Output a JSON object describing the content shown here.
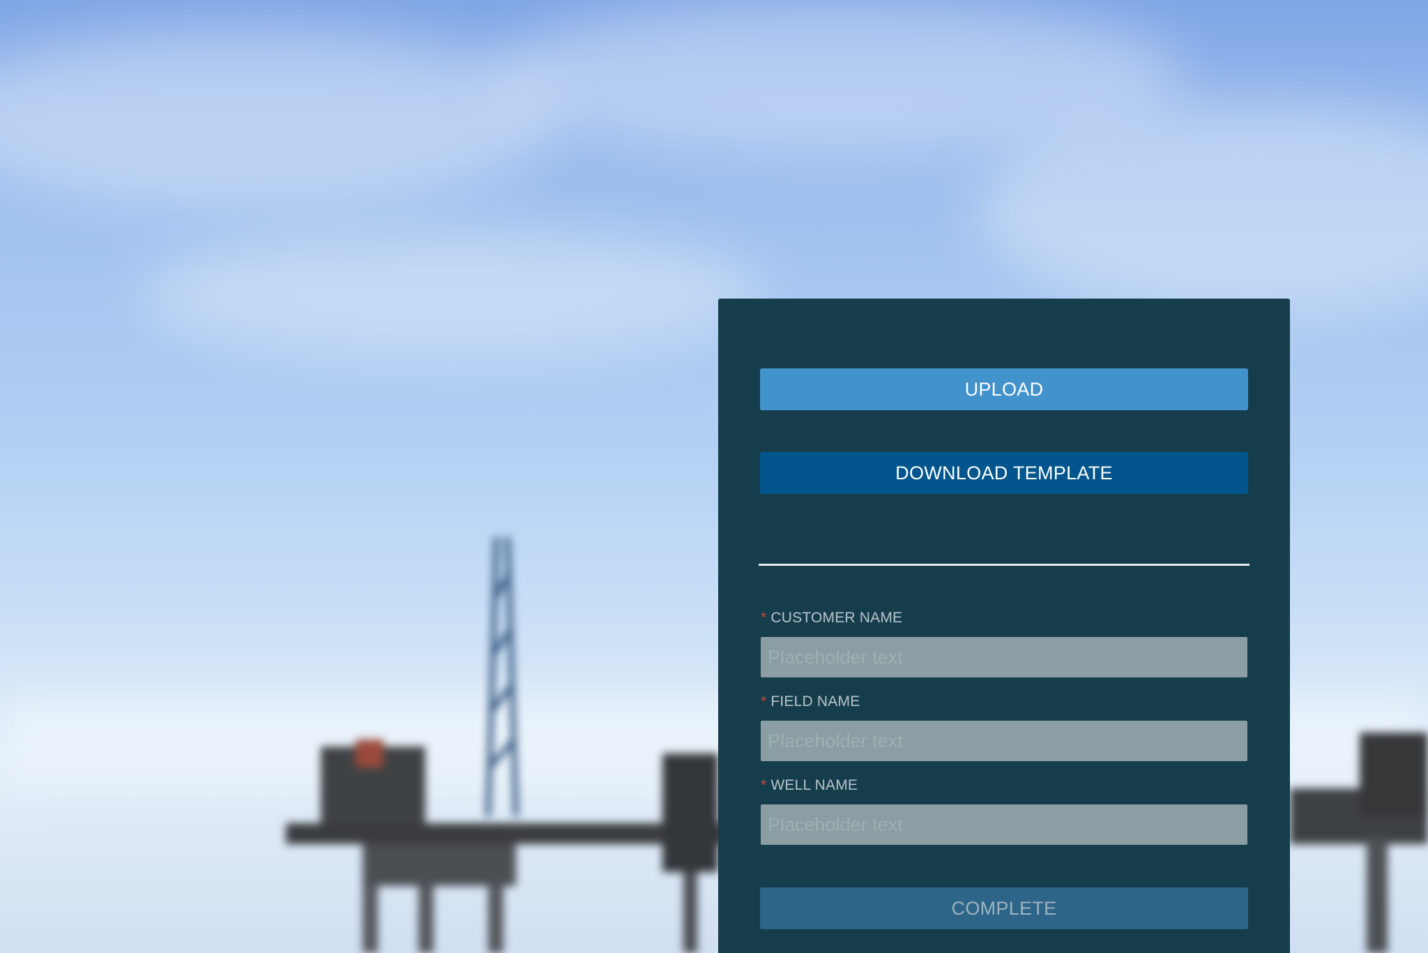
{
  "form": {
    "upload_label": "UPLOAD",
    "download_label": "DOWNLOAD TEMPLATE",
    "complete_label": "COMPLETE",
    "required_marker": "*",
    "fields": [
      {
        "label": "CUSTOMER NAME",
        "placeholder": "Placeholder text",
        "value": ""
      },
      {
        "label": "FIELD NAME",
        "placeholder": "Placeholder text",
        "value": ""
      },
      {
        "label": "WELL NAME",
        "placeholder": "Placeholder text",
        "value": ""
      }
    ]
  },
  "colors": {
    "panel_bg": "#163d4c",
    "upload_button": "#4292cb",
    "download_button": "#02568d",
    "complete_button": "#2c6587",
    "input_bg": "#8a9ea3",
    "required_marker": "#c44a3c"
  }
}
